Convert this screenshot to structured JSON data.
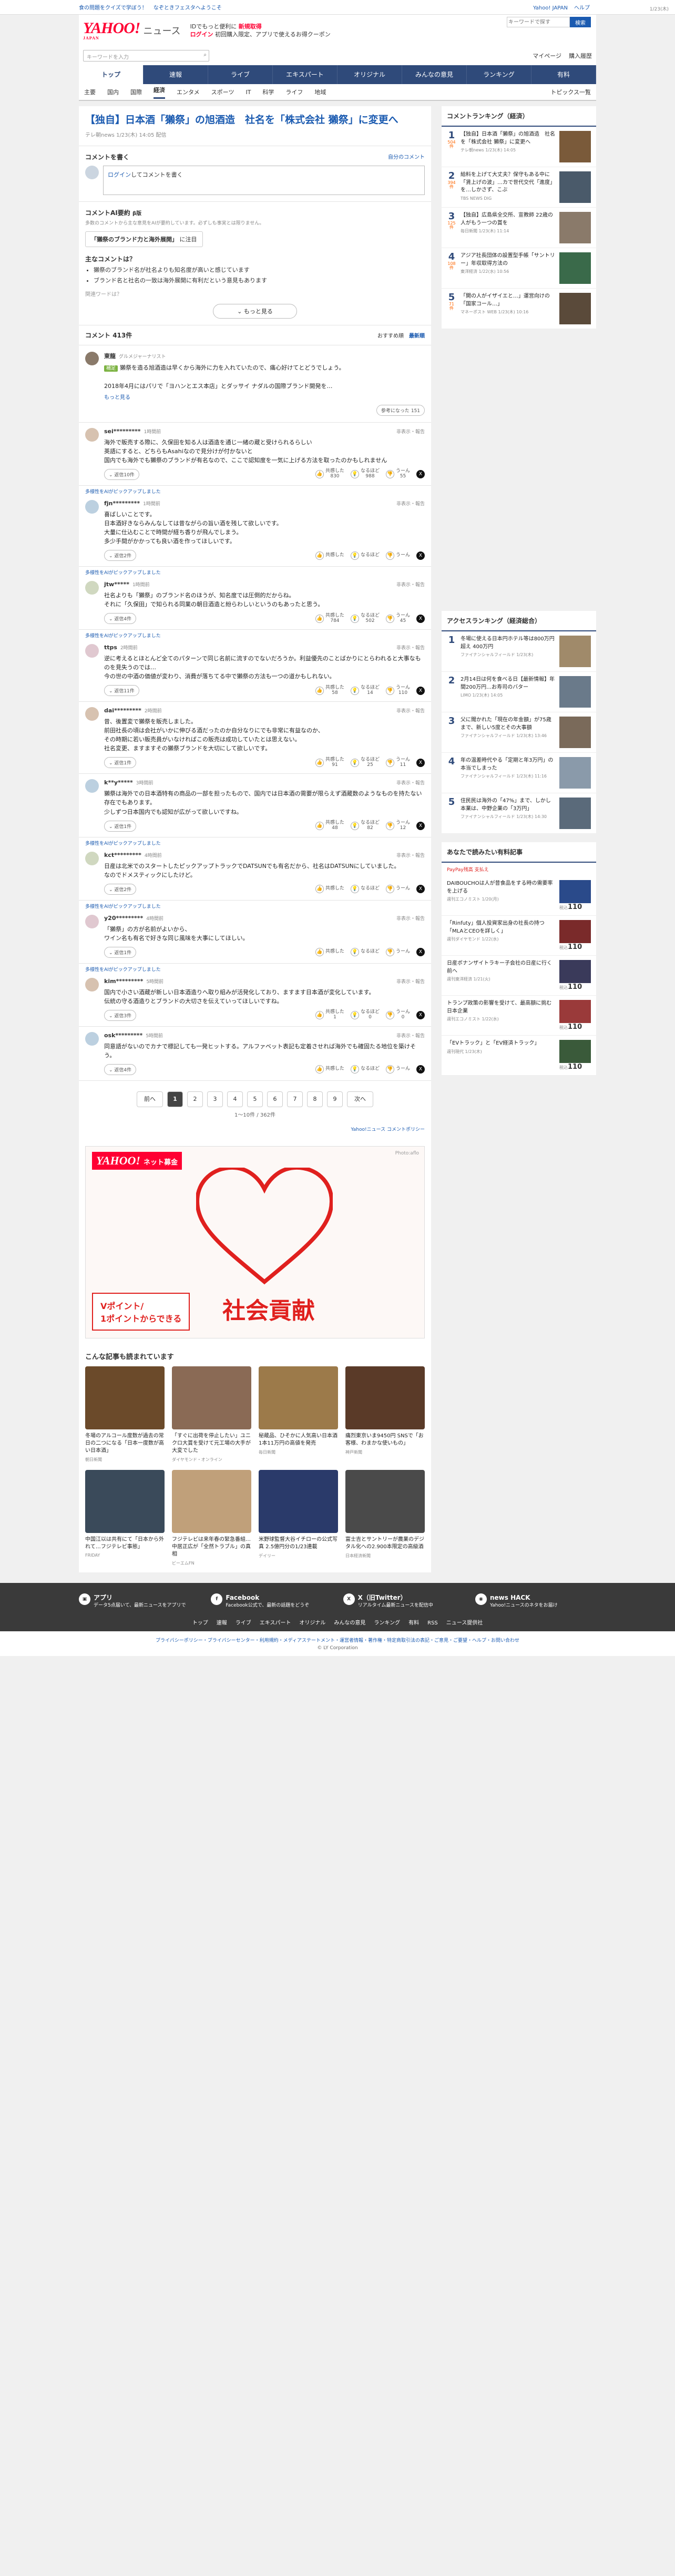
{
  "topstrip": {
    "left": [
      "食の問題をクイズで学ぼう！",
      "なぞときフェスタへようこそ"
    ],
    "right": [
      "Yahoo! JAPAN",
      "ヘルプ",
      "キーワードで探す",
      "検索"
    ]
  },
  "header": {
    "logo": "YAHOO!",
    "logo_sub": "JAPAN",
    "section": "ニュース",
    "promo_line1": "IDでもっと便利に",
    "promo_link1": "新規取得",
    "promo_line2": "ログイン",
    "promo_line3": "初回購入限定、アプリで使えるお得クーポン"
  },
  "search": {
    "placeholder": "キーワードを入力",
    "mypage": "マイページ",
    "purchase": "購入履歴"
  },
  "gnav": [
    "トップ",
    "速報",
    "ライブ",
    "エキスパート",
    "オリジナル",
    "みんなの意見",
    "ランキング",
    "有料"
  ],
  "subnav": {
    "items": [
      "主要",
      "国内",
      "国際",
      "経済",
      "エンタメ",
      "スポーツ",
      "IT",
      "科学",
      "ライフ",
      "地域"
    ],
    "active": "経済",
    "topics": "トピックス一覧"
  },
  "article": {
    "title": "【独自】日本酒「獺祭」の旭酒造　社名を「株式会社 獺祭」に変更へ",
    "source": "テレ朝news",
    "date": "1/23(木) 14:05 配信"
  },
  "comment_input": {
    "heading": "コメントを書く",
    "policy_link": "自分のコメント",
    "link": "ログイン",
    "text": "してコメントを書く"
  },
  "ai_summary": {
    "heading": "コメントAI要約",
    "beta": "β版",
    "sub": "多数のコメントから主な意見をAIが要約しています。必ずしも事実とは限りません。",
    "point_label": "「獺祭のブランド力と海外展開」",
    "point_suffix": "に注目",
    "list_title": "主なコメントは？",
    "items": [
      "獺祭のブランド名が社名よりも知名度が高いと感じています",
      "ブランド名と社名の一致は海外展開に有利だという意見もあります"
    ],
    "ref": "関連ワードは？",
    "more": "もっと見る"
  },
  "comments": {
    "title": "コメント",
    "count": "413件",
    "sort_labels": [
      "おすすめ順",
      "最新順"
    ]
  },
  "expert": {
    "name": "東龍",
    "role": "グルメジャーナリスト",
    "tag": "補足",
    "time": "1/23(木)",
    "text": "獺祭を造る旭酒造は早くから海外に力を入れていたので、痛心好けてとどうでしょう。\n\n2018年4月にはパリで「ヨハンとエス本店」とダッサイ ナダルの国際ブランド開発を…",
    "more": "もっと見る",
    "agree_label": "参考になった",
    "agree_count": "151"
  },
  "comment_list": [
    {
      "user": "sei*********",
      "time": "1時間前",
      "text": "海外で販売する際に、久保田を知る人は酒造を通じ一緒の蔵と受けられるらしい\n英語にすると、どちらもAsahiなので見分けが付かないと\n国内でも海外でも獺祭のブランドが有名なので、ここで認知度を一気に上げる方法を取ったのかもしれません",
      "reply": "返信10件",
      "like": "830",
      "nod": "988",
      "bad": "55"
    },
    {
      "user": "fjn*********",
      "time": "1時間前",
      "text": "喜ばしいことです。\n日本酒好きならみんなしては昔ながらの旨い酒を残して欲しいです。\n大量に仕込むことで時間が経ち香りが飛んでしまう。\n多少手間がかかっても良い酒を作ってほしいです。",
      "reply": "返信2件",
      "like": "",
      "nod": "",
      "bad": "",
      "tag": "多様性をAIがピックアップしました"
    },
    {
      "user": "jtw*****",
      "time": "1時間前",
      "text": "社名よりも「獺祭」のブランド名のほうが、知名度では圧倒的だからね。\nそれに「久保田」で知られる同業の朝日酒造と紛らわしいというのもあったと思う。",
      "reply": "返信4件",
      "like": "784",
      "nod": "502",
      "bad": "45",
      "tag": "多様性をAIがピックアップしました"
    },
    {
      "user": "ttps",
      "time": "2時間前",
      "text": "逆に考えるとほとんど全てのパターンで同じ名前に流すのでないだろうか。利益優先のことばかりにとらわれると大事なものを見失うのでは…\n今の世の中酒の価値が変わり、消費が落ちてる中で獺祭の方法も一つの道かもしれない。",
      "reply": "返信11件",
      "like": "58",
      "nod": "14",
      "bad": "110",
      "tag": "多様性をAIがピックアップしました"
    },
    {
      "user": "dai*********",
      "time": "2時間前",
      "text": "昔、後置変で獺祭を販売しました。\n前田社長の頃は会社がいかに伸びる酒だったのか自分なりにでも非常に有益なのか、\nその時期に若い販売員がいなければこの販売は成功していたとは思えない。\n社名変更、ますますその獺祭ブランドを大切にして欲しいです。",
      "reply": "返信1件",
      "like": "91",
      "nod": "25",
      "bad": "11"
    },
    {
      "user": "k**y*****",
      "time": "3時間前",
      "text": "獺祭は海外での日本酒特有の商品の一部を担ったもので、国内では日本酒の需要が限らえず酒蔵数のようなものを持たない存在でもあります。\n少しずつ日本国内でも認知が広がって欲しいですね。",
      "reply": "返信1件",
      "like": "48",
      "nod": "82",
      "bad": "12"
    },
    {
      "user": "kct*********",
      "time": "4時間前",
      "text": "日産は北米でのスタートしたピックアップトラックでDATSUNでも有名だから、社名はDATSUNにしていました。\nなのでドメスティックにしたけど。",
      "reply": "返信2件",
      "like": "",
      "nod": "",
      "bad": "",
      "tag": "多様性をAIがピックアップしました"
    },
    {
      "user": "y20*********",
      "time": "4時間前",
      "text": "「獺祭」の方が名前がよいから、\nワイン名も有名で好きな同じ風味を大事にしてほしい。",
      "reply": "返信1件",
      "like": "",
      "nod": "",
      "bad": "",
      "tag": "多様性をAIがピックアップしました"
    },
    {
      "user": "kim*********",
      "time": "5時間前",
      "text": "国内で小さい酒蔵が新しい日本酒造りへ取り組みが活発化しており、ますます日本酒が変化しています。\n伝統の守る酒造りとブランドの大切さを伝えていってほしいですね。",
      "reply": "返信3件",
      "like": "1",
      "nod": "0",
      "bad": "0",
      "tag": "多様性をAIがピックアップしました"
    },
    {
      "user": "osk*********",
      "time": "5時間前",
      "text": "同意語がないのでカナで標記しても一発ヒットする。アルファベット表記も定着させれば海外でも確固たる地位を築けそう。",
      "reply": "返信4件",
      "like": "",
      "nod": "",
      "bad": ""
    }
  ],
  "vote_labels": {
    "like": "共感した",
    "nod": "なるほど",
    "bad": "うーん"
  },
  "report_label": "非表示・報告",
  "pager": {
    "prev": "前へ",
    "pages": [
      "1",
      "2",
      "3",
      "4",
      "5",
      "6",
      "7",
      "8",
      "9"
    ],
    "next": "次へ",
    "count": "1〜10件 / 362件"
  },
  "comment_policy": "Yahoo!ニュース コメントポリシー",
  "ad": {
    "brand": "YAHOO!",
    "service": "ネット募金",
    "line1": "Vポイント/",
    "line2": "1ポイントからできる",
    "big": "社会貢献",
    "credit": "Photo:aflo"
  },
  "recs": {
    "title": "こんな記事も読まれています",
    "items": [
      {
        "title": "冬場のアルコール度数が過去の常日の二つになる「日本一度数が高い日本酒」",
        "src": "朝日新聞",
        "color": "#6b4a2a"
      },
      {
        "title": "「すぐに出荷を停止したい」ユニクロ大賞を受けて元工場の大手が大変でした",
        "src": "ダイヤモンド・オンライン",
        "color": "#8a6a55"
      },
      {
        "title": "秘蔵品、ひそかに人気高い日本酒 1本11万円の高値を発売",
        "src": "毎日新聞",
        "color": "#9c7a4a"
      },
      {
        "title": "痛烈東京いま9450円 SNSで「お客様、わまかな使いもの」",
        "src": "神戸新聞",
        "color": "#5a3a28"
      },
      {
        "title": "中国江以は共有にて「日本から外れて…フジテレビ事態」",
        "src": "FRIDAY",
        "color": "#3a4a5a"
      },
      {
        "title": "フジテレビは来年春の緊急番組…中居正広が「全然トラブル」の真相",
        "src": "ビーエムFN",
        "color": "#c0a07a"
      },
      {
        "title": "米野球監督大谷イチローの公式写真 2.5億円分の1/23連載",
        "src": "デイリー",
        "color": "#2a3a6a"
      },
      {
        "title": "富士吉とサントリーが農業のデジタル化への2.900本限定の高級酒",
        "src": "日本経済新聞",
        "color": "#4a4a4a"
      }
    ]
  },
  "ranking": {
    "title": "コメントランキング（経済）",
    "items": [
      {
        "num": "1",
        "cnt": "504件",
        "text": "【独自】日本酒「獺祭」の旭酒造　社名を「株式会社 獺祭」に変更へ",
        "src": "テレ朝news 1/23(木) 14:05",
        "color": "#7a5a3a"
      },
      {
        "num": "2",
        "cnt": "394件",
        "text": "給料を上げて大丈夫？保守もある中に「賃上げの波」…カで世代交代「進度」を…しかさず、こぶ",
        "src": "TBS NEWS DIG",
        "color": "#4a5a6a"
      },
      {
        "title": "",
        "num": "3",
        "cnt": "125件",
        "text": "【独自】広島県全交所、宣教師 22歳の人がもう一つの賞を",
        "src": "毎日新聞 1/23(木) 11:14",
        "color": "#8a7a6a"
      },
      {
        "num": "4",
        "cnt": "108件",
        "text": "アジア社長団体の設置型手帳「サントリー」年収取得方法の",
        "src": "東洋経済 1/22(水) 10:56",
        "color": "#3a6a4a"
      },
      {
        "num": "5",
        "cnt": "71件",
        "text": "「開の人がイザイエと…」運営向けの「国家コール…」",
        "src": "マネーポスト WEB 1/23(木) 10:16",
        "color": "#5a4a3a"
      }
    ]
  },
  "access": {
    "title": "アクセスランキング（経済総合）",
    "items": [
      {
        "num": "1",
        "text": "冬場に使える日本円ホテル等は800万円超え 400万円",
        "src": "ファイナンシャルフィールド 1/23(木)",
        "color": "#a08a6a"
      },
      {
        "num": "2",
        "text": "2月14日は何を食べる日【最新情報】年間200万円…お寿司のバター",
        "src": "LIMO 1/23(木) 14:05",
        "color": "#6a7a8a"
      },
      {
        "num": "3",
        "text": "父に聞かれた「現在の年金額」が75歳まで、新しい5度とその大事額",
        "src": "ファイナンシャルフィールド 1/23(木) 13:46",
        "color": "#7a6a5a"
      },
      {
        "num": "4",
        "text": "年の温差時代やる「定期と年3万円」の本当でしまった",
        "src": "ファイナンシャルフィールド 1/23(木) 11:16",
        "color": "#8a9aaa"
      },
      {
        "num": "5",
        "text": "住民民は海外の「47%」まで、しかし本業は、中野企業の「3万円」",
        "src": "ファイナンシャルフィールド 1/23(木) 14:30",
        "color": "#5a6a7a"
      }
    ]
  },
  "shop": {
    "title": "あなたで読みたい有料記事",
    "pay": "PayPay残高 支払え",
    "items": [
      {
        "text": "DAIBOUCHOは人が昔食品をする時の需要率を上げる",
        "src": "週刊エコノミスト 1/20(月)",
        "price": "110",
        "color": "#2a4a8a"
      },
      {
        "text": "「Rinfuty」個人投資家出身の社長の持つ「MLAとCEOを詳しく」",
        "src": "週刊ダイヤモンド 1/22(水)",
        "price": "110",
        "color": "#7a2a2a"
      },
      {
        "text": "日産ボナンザイトラキー子会社の日産に行く前へ",
        "src": "週刊東洋経済 1/21(火)",
        "price": "110",
        "color": "#3a3a5a"
      },
      {
        "text": "トランプ政策の影響を受けて、最高額に挑む日本企業",
        "src": "週刊エコノミスト 1/22(水)",
        "price": "110",
        "color": "#9a3a3a"
      },
      {
        "text": "「EVトラック」と「EV経済トラック」",
        "src": "週刊現代 1/23(木)",
        "price": "110",
        "color": "#3a5a3a"
      }
    ],
    "price_prefix": "税込"
  },
  "footer": {
    "items": [
      {
        "title": "アプリ",
        "desc": "データ5点届いて、最新ニュースをアプリで"
      },
      {
        "title": "Facebook",
        "desc": "Facebook公式で、最新の話題をどうぞ"
      },
      {
        "title": "X（旧Twitter）",
        "desc": "リアルタイム最新ニュースを配信中"
      },
      {
        "title": "news HACK",
        "desc": "Yahoo!ニュースのネタをお届け"
      }
    ],
    "links": [
      "トップ",
      "速報",
      "ライブ",
      "エキスパート",
      "オリジナル",
      "みんなの意見",
      "ランキング",
      "有料",
      "RSS",
      "ニュース提供社"
    ],
    "bottom": "プライバシーポリシー・プライバシーセンター・利用規約・メディアステートメント・運営者情報・著作権・特定商取引法の表記・ご意見・ご要望・ヘルプ・お問い合わせ",
    "copy": "© LY Corporation"
  }
}
